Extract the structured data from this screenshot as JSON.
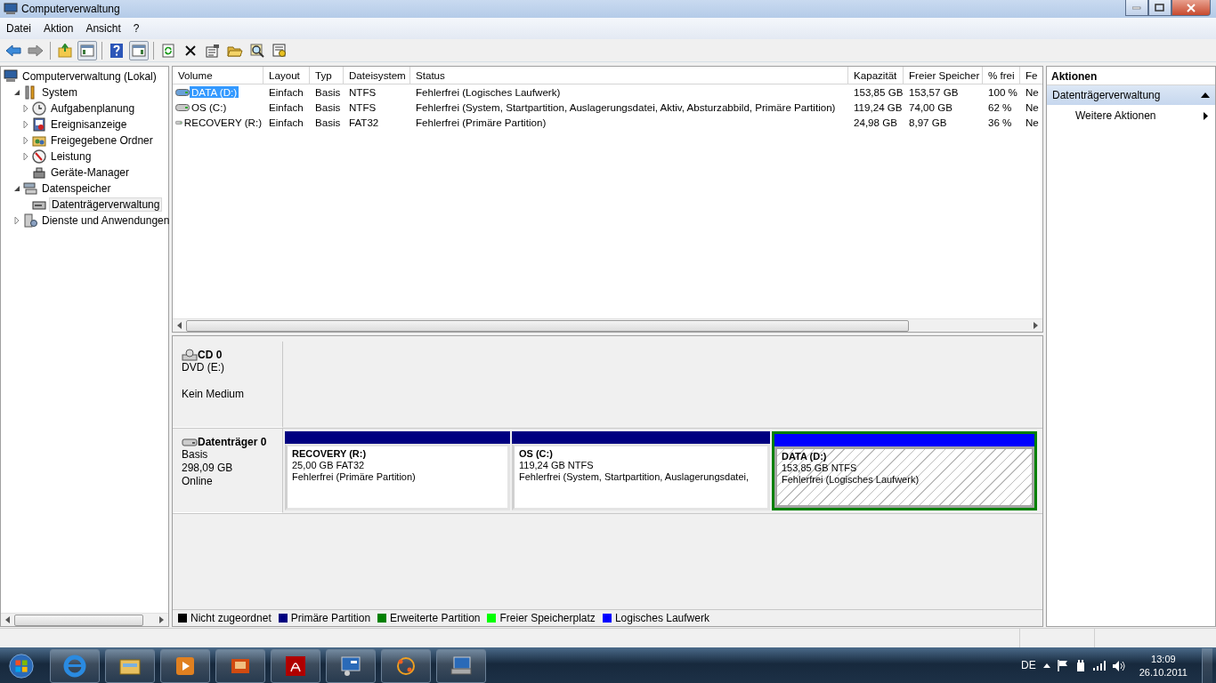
{
  "window": {
    "title": "Computerverwaltung"
  },
  "menu": [
    {
      "label": "Datei"
    },
    {
      "label": "Aktion"
    },
    {
      "label": "Ansicht"
    },
    {
      "label": "?"
    }
  ],
  "tree": [
    {
      "label": "Computerverwaltung (Lokal)",
      "selected": false,
      "children": [
        {
          "label": "System",
          "expanded": true,
          "selected": false,
          "children": [
            {
              "label": "Aufgabenplanung",
              "expanded": false,
              "selected": false
            },
            {
              "label": "Ereignisanzeige",
              "expanded": false,
              "selected": false
            },
            {
              "label": "Freigegebene Ordner",
              "expanded": false,
              "selected": false
            },
            {
              "label": "Leistung",
              "expanded": false,
              "selected": false
            },
            {
              "label": "Geräte-Manager",
              "selected": false
            }
          ]
        },
        {
          "label": "Datenspeicher",
          "expanded": true,
          "selected": false,
          "children": [
            {
              "label": "Datenträgerverwaltung",
              "selected": true
            }
          ]
        },
        {
          "label": "Dienste und Anwendungen",
          "expanded": false,
          "selected": false
        }
      ]
    }
  ],
  "volumes": {
    "columns": [
      "Volume",
      "Layout",
      "Typ",
      "Dateisystem",
      "Status",
      "Kapazität",
      "Freier Speicher",
      "% frei",
      "Fe"
    ],
    "rows": [
      {
        "selected": true,
        "cells": [
          "DATA (D:)",
          "Einfach",
          "Basis",
          "NTFS",
          "Fehlerfrei (Logisches Laufwerk)",
          "153,85 GB",
          "153,57 GB",
          "100 %",
          "Ne"
        ]
      },
      {
        "selected": false,
        "cells": [
          "OS (C:)",
          "Einfach",
          "Basis",
          "NTFS",
          "Fehlerfrei (System, Startpartition, Auslagerungsdatei, Aktiv, Absturzabbild, Primäre Partition)",
          "119,24 GB",
          "74,00 GB",
          "62 %",
          "Ne"
        ]
      },
      {
        "selected": false,
        "cells": [
          "RECOVERY (R:)",
          "Einfach",
          "Basis",
          "FAT32",
          "Fehlerfrei (Primäre Partition)",
          "24,98 GB",
          "8,97 GB",
          "36 %",
          "Ne"
        ]
      }
    ]
  },
  "disks": [
    {
      "kind": "cd",
      "name": "CD 0",
      "lines": [
        "DVD (E:)"
      ],
      "status": "Kein Medium"
    },
    {
      "kind": "hdd",
      "name": "Datenträger 0",
      "lines": [
        "Basis",
        "298,09 GB"
      ],
      "status": "Online",
      "partitions": [
        {
          "title": "RECOVERY  (R:)",
          "size": "25,00 GB FAT32",
          "status": "Fehlerfrei (Primäre Partition)",
          "color": "#000080",
          "selected": false,
          "in_extended": false
        },
        {
          "title": "OS  (C:)",
          "size": "119,24 GB NTFS",
          "status": "Fehlerfrei (System, Startpartition, Auslagerungsdatei,",
          "color": "#000080",
          "selected": false,
          "in_extended": false
        },
        {
          "title": "DATA  (D:)",
          "size": "153,85 GB NTFS",
          "status": "Fehlerfrei (Logisches Laufwerk)",
          "color": "#0000ff",
          "selected": true,
          "in_extended": true
        }
      ]
    }
  ],
  "legend": [
    {
      "label": "Nicht zugeordnet",
      "color": "#000000"
    },
    {
      "label": "Primäre Partition",
      "color": "#000080"
    },
    {
      "label": "Erweiterte Partition",
      "color": "#008000"
    },
    {
      "label": "Freier Speicherplatz",
      "color": "#00ff00"
    },
    {
      "label": "Logisches Laufwerk",
      "color": "#0000ff"
    }
  ],
  "actions": {
    "title": "Aktionen",
    "section": "Datenträgerverwaltung",
    "expanded": true,
    "items": [
      "Weitere Aktionen"
    ]
  },
  "taskbar": {
    "language": "DE",
    "time": "13:09",
    "date": "26.10.2011"
  }
}
